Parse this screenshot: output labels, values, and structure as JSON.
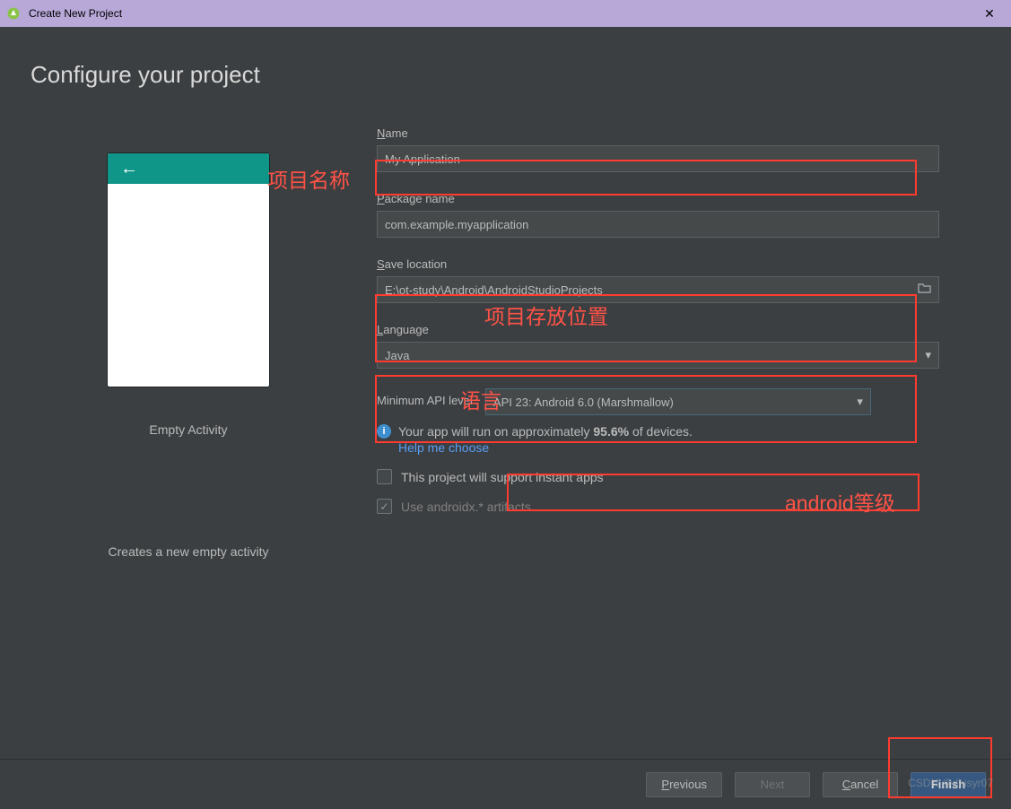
{
  "window": {
    "title": "Create New Project",
    "close_glyph": "✕"
  },
  "heading": "Configure your project",
  "preview": {
    "name": "Empty Activity",
    "description": "Creates a new empty activity",
    "back_glyph": "←"
  },
  "form": {
    "name_label": "Name",
    "name_value": "My Application",
    "package_label": "Package name",
    "package_value": "com.example.myapplication",
    "save_label": "Save location",
    "save_value": "E:\\ot-study\\Android\\AndroidStudioProjects",
    "language_label": "Language",
    "language_value": "Java",
    "api_label": "Minimum API level",
    "api_value": "API 23: Android 6.0 (Marshmallow)",
    "info_prefix": "Your app will run on approximately ",
    "info_pct": "95.6%",
    "info_suffix": " of devices.",
    "help_link": "Help me choose",
    "instant_apps": "This project will support instant apps",
    "androidx": "Use androidx.* artifacts",
    "dropdown_arrow": "▾",
    "check_glyph": "✓"
  },
  "buttons": {
    "previous": "Previous",
    "next": "Next",
    "cancel": "Cancel",
    "finish": "Finish"
  },
  "annotations": {
    "name_label": "项目名称",
    "save_label": "项目存放位置",
    "language_label": "语言",
    "api_label": "android等级"
  },
  "watermark": "CSDN @daisyr07"
}
